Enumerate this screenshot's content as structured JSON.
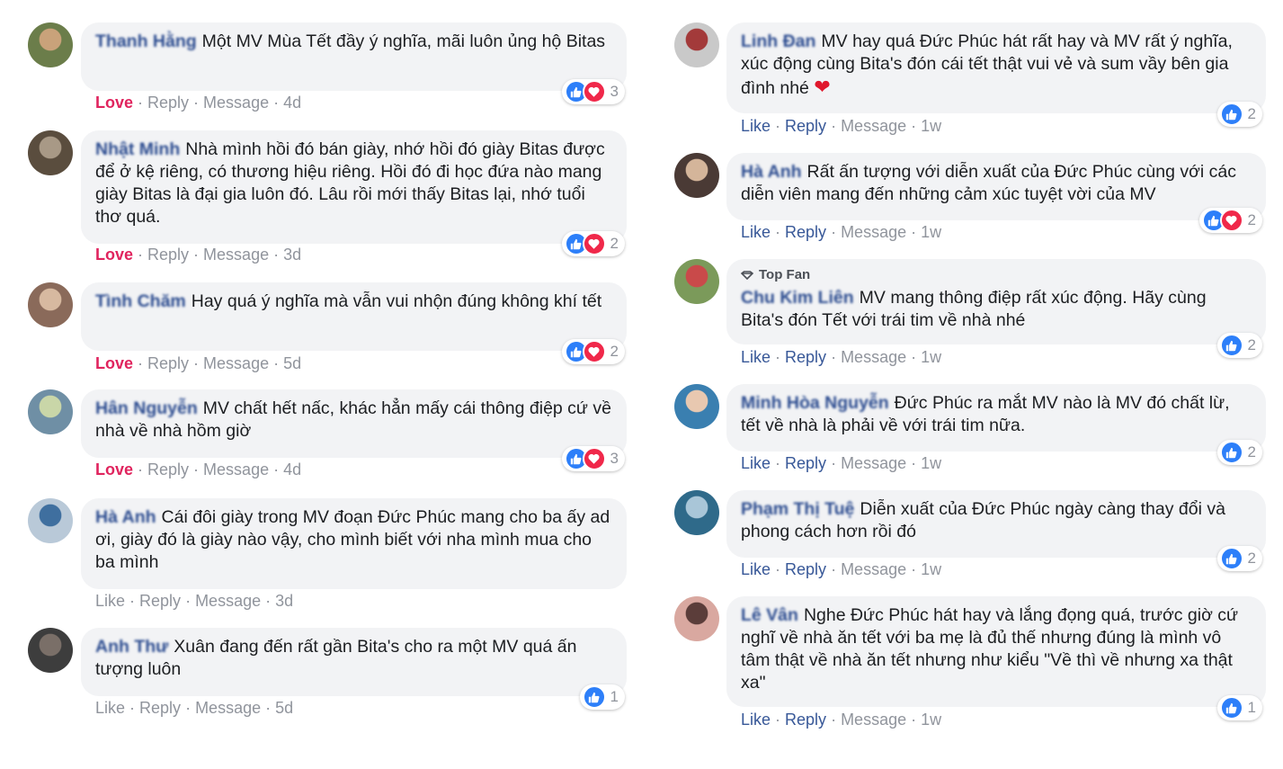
{
  "labels": {
    "love": "Love",
    "like": "Like",
    "reply": "Reply",
    "message": "Message",
    "sep": "·",
    "top_fan": "Top Fan"
  },
  "colors": {
    "link": "#385898",
    "name": "#2b4b8f",
    "love": "#e0245e",
    "muted": "#90949c",
    "bubble_bg": "#f2f3f5",
    "like_blue": "#2d7ff9",
    "heart_red": "#f0284a"
  },
  "left_comments": [
    {
      "name": "Thanh Hằng",
      "text": "Một MV Mùa Tết đầy ý nghĩa, mãi luôn ủng hộ Bitas",
      "action": "Love",
      "reply_style": "link",
      "time": "4d",
      "reactions": [
        "like",
        "heart"
      ],
      "count": "3"
    },
    {
      "name": "Nhật Minh",
      "text": "Nhà mình hồi đó bán giày, nhớ hồi đó giày Bitas được để ở kệ riêng, có thương hiệu riêng. Hồi đó đi học đứa nào mang giày Bitas là đại gia luôn đó. Lâu rồi mới thấy Bitas lại, nhớ tuổi thơ quá.",
      "action": "Love",
      "reply_style": "link",
      "time": "3d",
      "reactions": [
        "like",
        "heart"
      ],
      "count": "2"
    },
    {
      "name": "Tình Chăm",
      "text": "Hay quá ý nghĩa mà vẫn vui nhộn đúng không khí tết",
      "action": "Love",
      "reply_style": "link",
      "time": "5d",
      "reactions": [
        "like",
        "heart"
      ],
      "count": "2"
    },
    {
      "name": "Hân Nguyễn",
      "text": "MV chất hết nấc, khác hẳn mấy cái thông điệp cứ về nhà về nhà hồm giờ",
      "action": "Love",
      "reply_style": "link",
      "time": "4d",
      "reactions": [
        "like",
        "heart"
      ],
      "count": "3"
    },
    {
      "name": "Hà Anh",
      "text": "Cái đôi giày trong MV đoạn Đức Phúc mang cho ba ấy ad ơi, giày đó là giày nào vậy, cho mình biết với nha mình mua cho ba mình",
      "action": "Like",
      "reply_style": "plain",
      "time": "3d",
      "reactions": [],
      "count": ""
    },
    {
      "name": "Anh Thư",
      "text": "Xuân đang đến rất gần Bita's cho ra một MV quá ấn tượng luôn",
      "action": "Like",
      "reply_style": "plain",
      "time": "5d",
      "reactions": [
        "like"
      ],
      "count": "1"
    }
  ],
  "right_comments": [
    {
      "name": "Linh Đan",
      "text": "MV hay quá Đức Phúc hát rất hay và MV rất ý nghĩa, xúc động cùng Bita's đón cái tết thật vui vẻ và sum vầy bên gia đình nhé",
      "emoji": "❤",
      "action": "Like",
      "reply_style": "link",
      "time": "1w",
      "reactions": [
        "like"
      ],
      "count": "2"
    },
    {
      "name": "Hà Anh",
      "text": "Rất ấn tượng với diễn xuất của Đức Phúc cùng với các diễn viên mang đến những cảm xúc tuyệt vời của MV",
      "action": "Like",
      "reply_style": "link",
      "time": "1w",
      "reactions": [
        "like",
        "heart"
      ],
      "count": "2"
    },
    {
      "name": "Chu Kim Liên",
      "top_fan": true,
      "text": "MV mang thông điệp rất xúc động. Hãy cùng Bita's đón Tết với trái tim về nhà nhé",
      "action": "Like",
      "reply_style": "link",
      "time": "1w",
      "reactions": [
        "like"
      ],
      "count": "2"
    },
    {
      "name": "Minh Hòa Nguyễn",
      "text": "Đức Phúc ra mắt MV nào là MV đó chất lừ, tết về nhà là phải về với trái tim nữa.",
      "action": "Like",
      "reply_style": "link",
      "time": "1w",
      "reactions": [
        "like"
      ],
      "count": "2"
    },
    {
      "name": "Phạm Thị Tuệ",
      "text": "Diễn xuất của Đức Phúc ngày càng thay đổi và phong cách hơn rồi đó",
      "action": "Like",
      "reply_style": "link",
      "time": "1w",
      "reactions": [
        "like"
      ],
      "count": "2"
    },
    {
      "name": "Lê Vân",
      "text": "Nghe Đức Phúc hát hay và lắng đọng quá, trước giờ cứ nghĩ về nhà ăn tết với ba mẹ là đủ thế nhưng đúng là mình vô tâm thật về nhà ăn tết nhưng như kiểu \"Về thì về nhưng xa thật xa\"",
      "action": "Like",
      "reply_style": "link",
      "time": "1w",
      "reactions": [
        "like"
      ],
      "count": "1"
    }
  ]
}
